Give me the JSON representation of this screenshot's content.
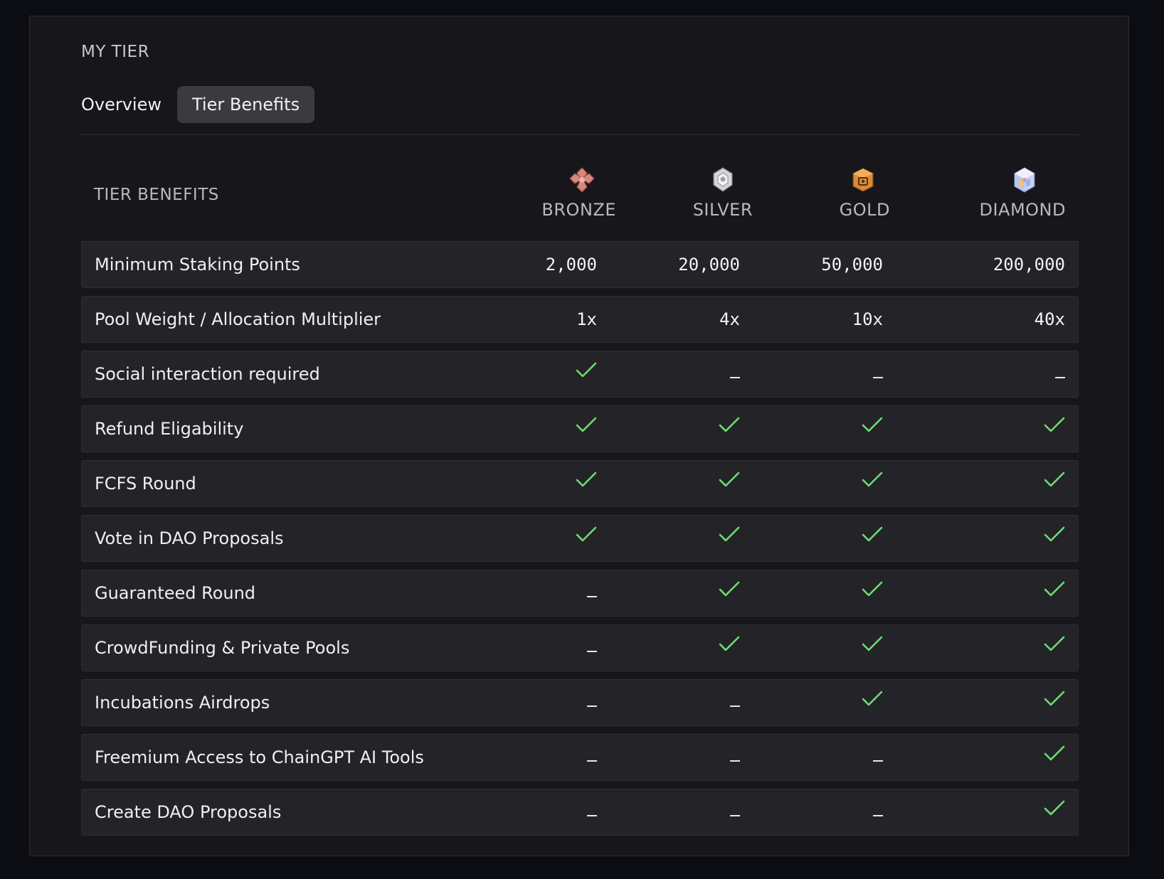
{
  "section_title": "MY TIER",
  "tabs": [
    {
      "label": "Overview",
      "active": false
    },
    {
      "label": "Tier Benefits",
      "active": true
    }
  ],
  "table": {
    "header_label": "TIER BENEFITS",
    "tiers": [
      {
        "name": "BRONZE",
        "icon": "bronze-tier-icon",
        "color": "#d9877a"
      },
      {
        "name": "SILVER",
        "icon": "silver-tier-icon",
        "color": "#cfd0d4"
      },
      {
        "name": "GOLD",
        "icon": "gold-tier-icon",
        "color": "#d98a3a"
      },
      {
        "name": "DIAMOND",
        "icon": "diamond-tier-icon",
        "color": "#a9b6e8"
      }
    ],
    "rows": [
      {
        "label": "Minimum Staking Points",
        "values": [
          "2,000",
          "20,000",
          "50,000",
          "200,000"
        ]
      },
      {
        "label": "Pool Weight / Allocation Multiplier",
        "values": [
          "1x",
          "4x",
          "10x",
          "40x"
        ]
      },
      {
        "label": "Social interaction required",
        "values": [
          "check",
          "dash",
          "dash",
          "dash"
        ]
      },
      {
        "label": "Refund Eligability",
        "values": [
          "check",
          "check",
          "check",
          "check"
        ]
      },
      {
        "label": "FCFS Round",
        "values": [
          "check",
          "check",
          "check",
          "check"
        ]
      },
      {
        "label": "Vote in DAO Proposals",
        "values": [
          "check",
          "check",
          "check",
          "check"
        ]
      },
      {
        "label": "Guaranteed Round",
        "values": [
          "dash",
          "check",
          "check",
          "check"
        ]
      },
      {
        "label": "CrowdFunding & Private Pools",
        "values": [
          "dash",
          "check",
          "check",
          "check"
        ]
      },
      {
        "label": "Incubations Airdrops",
        "values": [
          "dash",
          "dash",
          "check",
          "check"
        ]
      },
      {
        "label": "Freemium Access to ChainGPT AI Tools",
        "values": [
          "dash",
          "dash",
          "dash",
          "check"
        ]
      },
      {
        "label": "Create DAO Proposals",
        "values": [
          "dash",
          "dash",
          "dash",
          "check"
        ]
      }
    ]
  },
  "colors": {
    "check": "#6fdc74",
    "panel_bg": "#17171b",
    "row_bg": "#232328",
    "active_tab_bg": "#3a3b40"
  }
}
